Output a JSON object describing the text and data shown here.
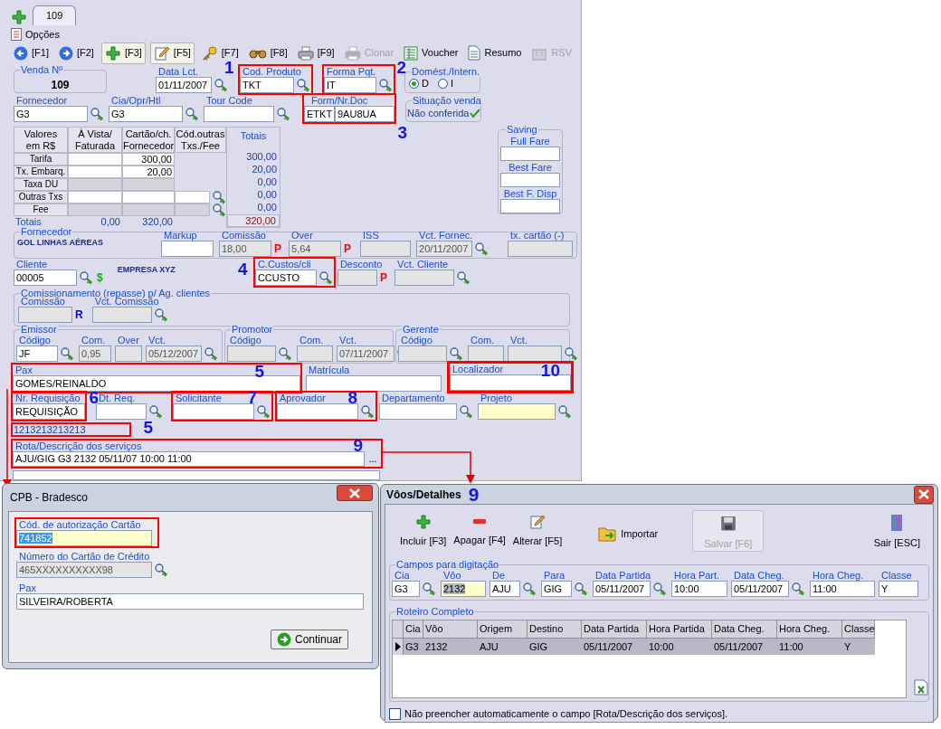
{
  "tabs": [
    {
      "label": "109",
      "selected": true
    }
  ],
  "menu": {
    "label": "Opções"
  },
  "toolbar": [
    {
      "kind": "back",
      "label": "[F1]",
      "raised": false,
      "disabled": false
    },
    {
      "kind": "forward",
      "label": "[F2]",
      "raised": false,
      "disabled": false
    },
    {
      "kind": "add",
      "label": "[F3]",
      "raised": true,
      "disabled": false
    },
    {
      "kind": "edit",
      "label": "[F5]",
      "raised": true,
      "disabled": false
    },
    {
      "kind": "key",
      "label": "[F7]",
      "raised": false,
      "disabled": false
    },
    {
      "kind": "binoculars",
      "label": "[F8]",
      "raised": false,
      "disabled": false
    },
    {
      "kind": "print",
      "label": "[F9]",
      "raised": false,
      "disabled": false
    },
    {
      "kind": "clone",
      "label": "Clonar",
      "raised": false,
      "disabled": true
    },
    {
      "kind": "voucher",
      "label": "Voucher",
      "raised": false,
      "disabled": false
    },
    {
      "kind": "summary",
      "label": "Resumo",
      "raised": false,
      "disabled": false
    },
    {
      "kind": "rsv",
      "label": "RSV",
      "raised": false,
      "disabled": true
    }
  ],
  "venda": {
    "label": "Venda Nº",
    "value": "109"
  },
  "data_lct": {
    "label": "Data Lct.",
    "value": "01/11/2007",
    "lookup": true
  },
  "cod_produto": {
    "label": "Cod. Produto",
    "value": "TKT",
    "lookup": true,
    "highlighted": true,
    "marker": "1"
  },
  "forma_pqt": {
    "label": "Forma Pqt.",
    "value": "IT",
    "lookup": true,
    "highlighted": true,
    "marker": "2"
  },
  "domestico": {
    "label": "Domést./Intern.",
    "options": [
      {
        "label": "D",
        "selected": true
      },
      {
        "label": "I",
        "selected": false
      }
    ]
  },
  "fornecedor": {
    "label": "Fornecedor",
    "value": "G3",
    "lookup": true
  },
  "cia": {
    "label": "Cia/Opr/Htl",
    "value": "G3",
    "lookup": true
  },
  "tour_code": {
    "label": "Tour Code",
    "lookup": true
  },
  "form_doc": {
    "label": "Form/Nr.Doc",
    "values": [
      "ETKT",
      "9AU8UA"
    ],
    "highlighted": true,
    "marker": "3"
  },
  "situacao": {
    "label": "Situação venda",
    "value": "Não conferida"
  },
  "valores": {
    "columns": [
      "Valores em R$",
      "À Vista/ Faturada",
      "Cartão/ch. Fornecedor",
      "Cód.outras Txs./Fee"
    ],
    "total_column": "Totais",
    "rows": [
      {
        "label": "Tarifa",
        "a_vista": {
          "disabled": false
        },
        "cartao": {
          "value": "300,00",
          "disabled": false
        },
        "total": "300,00"
      },
      {
        "label": "Tx. Embarq.",
        "a_vista": {
          "disabled": false
        },
        "cartao": {
          "value": "20,00",
          "disabled": false
        },
        "total": "20,00"
      },
      {
        "label": "Taxa DU",
        "a_vista": {
          "disabled": true
        },
        "cartao": {
          "disabled": true
        },
        "total": "0,00"
      },
      {
        "label": "Outras Txs",
        "a_vista": {
          "disabled": false
        },
        "cartao": {
          "disabled": false
        },
        "cod": {
          "disabled": false
        },
        "total": "0,00"
      },
      {
        "label": "Fee",
        "a_vista": {
          "disabled": true
        },
        "cartao": {
          "disabled": true
        },
        "cod": {
          "disabled": true
        },
        "total": "0,00"
      }
    ],
    "footer": {
      "label": "Totais",
      "a_vista": "0,00",
      "cartao": "320,00",
      "total": "320,00"
    }
  },
  "saving": {
    "label": "Saving",
    "fields": [
      {
        "label": "Full Fare"
      },
      {
        "label": "Best Fare"
      },
      {
        "label": "Best F. Disp"
      }
    ]
  },
  "fornecedor_info": {
    "label": "Fornecedor",
    "name": "GOL LINHAS AÉREAS",
    "fields": [
      {
        "label": "Markup",
        "disabled": false
      },
      {
        "label": "Comissão",
        "value": "18,00",
        "disabled": true,
        "suffix": {
          "text": "P",
          "color": "#ff0000"
        }
      },
      {
        "label": "Over",
        "value": "5,64",
        "disabled": true,
        "suffix": {
          "text": "P",
          "color": "#ff0000"
        }
      },
      {
        "label": "ISS",
        "disabled": true
      },
      {
        "label": "Vct. Fornec.",
        "value": "20/11/2007",
        "disabled": true,
        "lookup": true
      },
      {
        "label": "tx. cartão (-)",
        "disabled": true
      }
    ]
  },
  "cliente": {
    "label": "Cliente",
    "value": "00005",
    "lookup": true,
    "suffix": {
      "text": "$",
      "color": "#20a020"
    }
  },
  "cliente_nome": "EMPRESA XYZ",
  "centro_custo": {
    "label": "C.Custos/cli",
    "value": "CCUSTO",
    "lookup": true,
    "highlighted": true,
    "marker": "4"
  },
  "desconto": {
    "label": "Desconto",
    "disabled": true,
    "suffix": {
      "text": "P",
      "color": "#ff0000"
    }
  },
  "vct_cliente": {
    "label": "Vct. Cliente",
    "disabled": true,
    "lookup": true
  },
  "comissionamento": {
    "label": "Comissionamento (repasse) p/ Ag. clientes",
    "fields": [
      {
        "label": "Comissão",
        "disabled": true,
        "suffix": {
          "text": "R",
          "color": "#0000ff"
        }
      },
      {
        "label": "Vct. Comissão",
        "disabled": true,
        "lookup": true
      }
    ]
  },
  "equipe": [
    {
      "label": "Emissor",
      "fields": [
        {
          "label": "Código",
          "value": "JF",
          "disabled": false,
          "lookup": true
        },
        {
          "label": "Com.",
          "value": "0,95",
          "disabled": true
        },
        {
          "label": "Over",
          "disabled": true
        },
        {
          "label": "Vct.",
          "value": "05/12/2007",
          "disabled": true,
          "lookup": true
        }
      ]
    },
    {
      "label": "Promotor",
      "fields": [
        {
          "label": "Código",
          "disabled": true,
          "lookup": true
        },
        {
          "label": "Com.",
          "disabled": true
        },
        {
          "label": "Vct.",
          "value": "07/11/2007",
          "disabled": true,
          "lookup": true
        }
      ]
    },
    {
      "label": "Gerente",
      "fields": [
        {
          "label": "Código",
          "disabled": true,
          "lookup": true
        },
        {
          "label": "Com.",
          "disabled": true
        },
        {
          "label": "Vct.",
          "disabled": true,
          "lookup": true
        }
      ]
    }
  ],
  "pax": {
    "label": "Pax",
    "value": "GOMES/REINALDO",
    "highlighted": true,
    "marker": "5"
  },
  "matricula": {
    "label": "Matrícula"
  },
  "localizador": {
    "label": "Localizador",
    "highlighted": true,
    "marker": "10"
  },
  "nr_requisicao": {
    "label": "Nr. Requisição",
    "value": "REQUISIÇÃO",
    "highlighted": true,
    "marker": "6"
  },
  "dt_req": {
    "label": "Dt. Req.",
    "lookup": true
  },
  "solicitante": {
    "label": "Solicitante",
    "lookup": true,
    "highlighted": true,
    "marker": "7"
  },
  "aprovador": {
    "label": "Aprovador",
    "lookup": true,
    "highlighted": true,
    "marker": "8"
  },
  "departamento": {
    "label": "Departamento",
    "lookup": true
  },
  "projeto": {
    "label": "Projeto",
    "lookup": true,
    "color": "#ffffcc"
  },
  "codigo_extra": {
    "value": "1213213213213",
    "highlighted": true,
    "marker": "5"
  },
  "rota": {
    "label": "Rota/Descrição dos serviços",
    "value": "AJU/GIG G3 2132 05/11/07 10:00 11:00",
    "button": "...",
    "highlighted": true,
    "marker": "9"
  },
  "cpb_dialog": {
    "title": "CPB - Bradesco",
    "fields": [
      {
        "label": "Cód. de autorização Cartão",
        "value": "741852",
        "disabled": false,
        "color": "#ffffcc",
        "text_selected": true,
        "highlighted": true
      },
      {
        "label": "Número do Cartão de Crédito",
        "value": "465XXXXXXXXXX98",
        "disabled": true,
        "lookup": true
      },
      {
        "label": "Pax",
        "value": "SILVEIRA/ROBERTA",
        "disabled": false
      }
    ],
    "button": "Continuar"
  },
  "voos_dialog": {
    "title": "Vôos/Detalhes",
    "marker": "9",
    "toolbar": [
      {
        "kind": "add",
        "label": "Incluir [F3]",
        "disabled": false
      },
      {
        "kind": "remove",
        "label": "Apagar [F4]",
        "disabled": false
      },
      {
        "kind": "edit",
        "label": "Alterar [F5]",
        "disabled": false
      },
      {
        "kind": "import",
        "label": "Importar",
        "disabled": false
      },
      {
        "kind": "save",
        "label": "Salvar [F6]",
        "disabled": true
      },
      {
        "kind": "exit",
        "label": "Sair [ESC]",
        "disabled": false
      }
    ],
    "campos": {
      "label": "Campos para digitação",
      "fields": [
        {
          "label": "Cia",
          "value": "G3",
          "lookup": true,
          "disabled": false
        },
        {
          "label": "Vôo",
          "value": "2132",
          "disabled": false,
          "color": "#ffffcc",
          "text_selected": true
        },
        {
          "label": "De",
          "value": "AJU",
          "lookup": true,
          "disabled": false
        },
        {
          "label": "Para",
          "value": "GIG",
          "lookup": true,
          "disabled": false
        },
        {
          "label": "Data Partida",
          "value": "05/11/2007",
          "lookup": true,
          "disabled": false
        },
        {
          "label": "Hora Part.",
          "value": "10:00",
          "disabled": false
        },
        {
          "label": "Data Cheg.",
          "value": "05/11/2007",
          "lookup": true,
          "disabled": false
        },
        {
          "label": "Hora Cheg.",
          "value": "11:00",
          "disabled": false
        },
        {
          "label": "Classe",
          "value": "Y",
          "disabled": false
        }
      ]
    },
    "roteiro": {
      "label": "Roteiro Completo",
      "columns": [
        "Cia",
        "Vôo",
        "Origem",
        "Destino",
        "Data Partida",
        "Hora Partida",
        "Data Cheg.",
        "Hora Cheg.",
        "Classe"
      ],
      "rows": [
        {
          "cells": [
            "G3",
            "2132",
            "AJU",
            "GIG",
            "05/11/2007",
            "10:00",
            "05/11/2007",
            "11:00",
            "Y"
          ],
          "selected": true
        }
      ]
    },
    "option": {
      "label": "Não preencher automaticamente o campo [Rota/Descrição dos serviços].",
      "checked": false
    }
  }
}
